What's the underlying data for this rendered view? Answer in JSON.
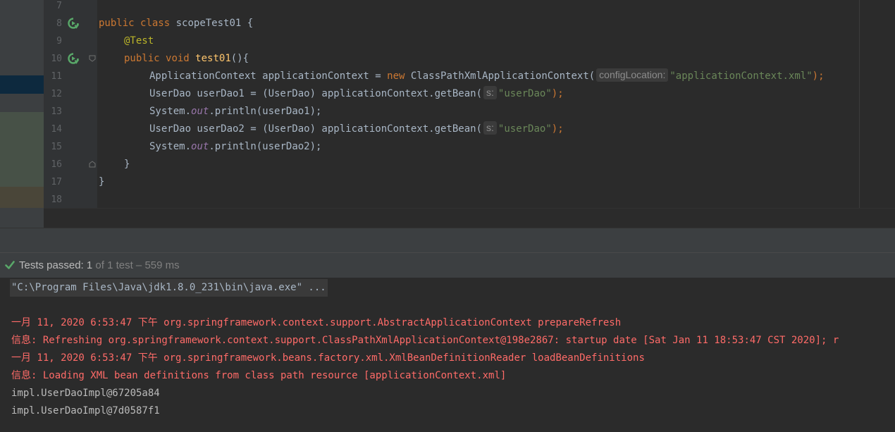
{
  "editor": {
    "line_numbers": [
      "7",
      "8",
      "9",
      "10",
      "11",
      "12",
      "13",
      "14",
      "15",
      "16",
      "17",
      "18"
    ],
    "code": {
      "l8": {
        "kw1": "public",
        "kw2": "class",
        "rest": " scopeTest01 {"
      },
      "l9": {
        "annotation": "@Test"
      },
      "l10": {
        "kw1": "public",
        "kw2": "void",
        "method": "test01",
        "rest": "(){"
      },
      "l11": {
        "pre": "ApplicationContext applicationContext = ",
        "kw": "new",
        "mid": " ClassPathXmlApplicationContext(",
        "hint": "configLocation:",
        "str": "\"applicationContext.xml\"",
        "end": ");"
      },
      "l12": {
        "pre": "UserDao userDao1 = (UserDao) applicationContext.getBean(",
        "hint": "s:",
        "str": "\"userDao\"",
        "end": ");"
      },
      "l13": {
        "pre": "System.",
        "field": "out",
        "end": ".println(userDao1);"
      },
      "l14": {
        "pre": "UserDao userDao2 = (UserDao) applicationContext.getBean(",
        "hint": "s:",
        "str": "\"userDao\"",
        "end": ");"
      },
      "l15": {
        "pre": "System.",
        "field": "out",
        "end": ".println(userDao2);"
      },
      "l16": {
        "text": "}"
      },
      "l17": {
        "text": "}"
      }
    }
  },
  "run": {
    "status_label": "Tests passed: ",
    "passed_count": "1",
    "status_detail": " of 1 test – 559 ms"
  },
  "console": {
    "command": "\"C:\\Program Files\\Java\\jdk1.8.0_231\\bin\\java.exe\" ...",
    "lines": [
      "一月 11, 2020 6:53:47 下午 org.springframework.context.support.AbstractApplicationContext prepareRefresh",
      "信息: Refreshing org.springframework.context.support.ClassPathXmlApplicationContext@198e2867: startup date [Sat Jan 11 18:53:47 CST 2020]; r",
      "一月 11, 2020 6:53:47 下午 org.springframework.beans.factory.xml.XmlBeanDefinitionReader loadBeanDefinitions",
      "信息: Loading XML bean definitions from class path resource [applicationContext.xml]",
      "impl.UserDaoImpl@67205a84",
      "impl.UserDaoImpl@7d0587f1"
    ]
  },
  "colors": {
    "editor_bg": "#2b2b2b",
    "keyword": "#cc7832",
    "string": "#6a8759",
    "annotation": "#bbb529",
    "method": "#ffc66d",
    "error_text": "#ff6b68",
    "passed_check": "#59a869"
  }
}
